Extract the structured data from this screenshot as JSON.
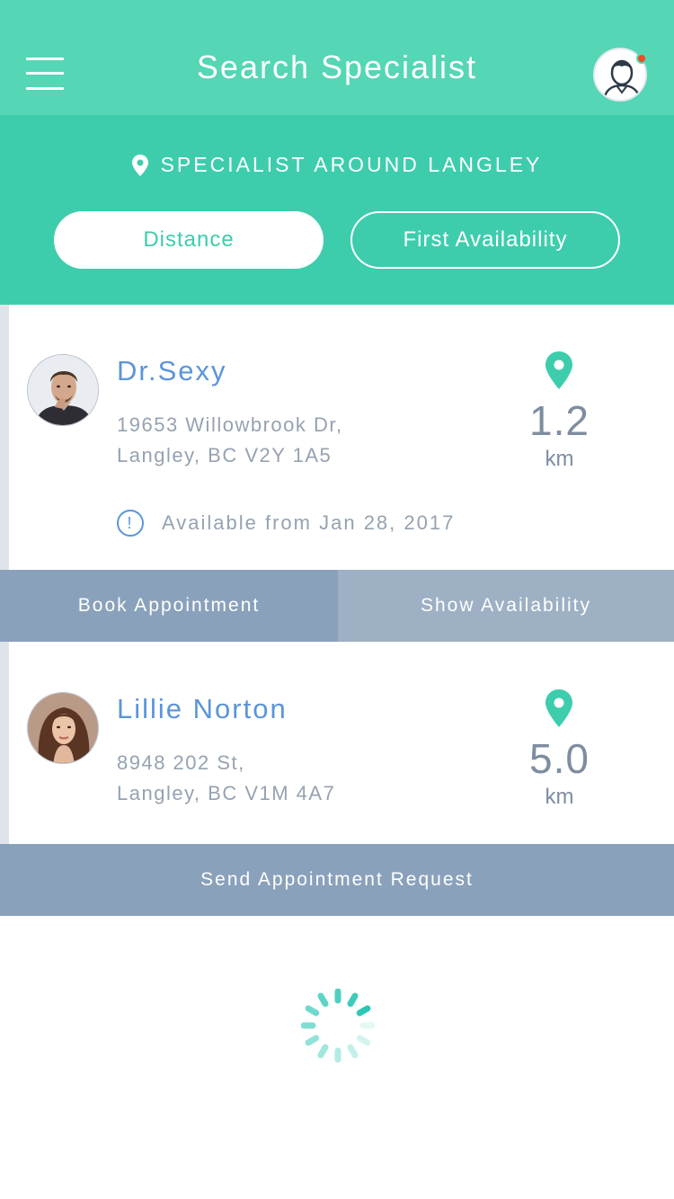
{
  "navbar": {
    "title": "Search Specialist",
    "menu_icon": "hamburger-icon",
    "avatar_icon": "user-avatar-icon",
    "has_notification": true
  },
  "header": {
    "location_text": "SPECIALIST AROUND LANGLEY",
    "location_icon": "map-pin-icon",
    "sort_options": [
      "Distance",
      "First Availability"
    ],
    "active_sort": "Distance"
  },
  "specialists": [
    {
      "name": "Dr.Sexy",
      "address_line1": "19653 Willowbrook Dr,",
      "address_line2": "Langley, BC V2Y 1A5",
      "distance": "1.2",
      "distance_unit": "km",
      "availability": "Available from Jan 28, 2017",
      "actions": [
        "Book Appointment",
        "Show Availability"
      ]
    },
    {
      "name": "Lillie Norton",
      "address_line1": "8948 202 St,",
      "address_line2": "Langley, BC V1M 4A7",
      "distance": "5.0",
      "distance_unit": "km",
      "actions": [
        "Send Appointment Request"
      ]
    }
  ],
  "colors": {
    "nav_bg": "#55d6b5",
    "header_bg": "#3dcdad",
    "name_blue": "#5b95d9",
    "pin_green": "#3dcdad",
    "action_dark": "#8aa1bb",
    "action_light": "#9db0c4",
    "notification": "#f04a22"
  }
}
